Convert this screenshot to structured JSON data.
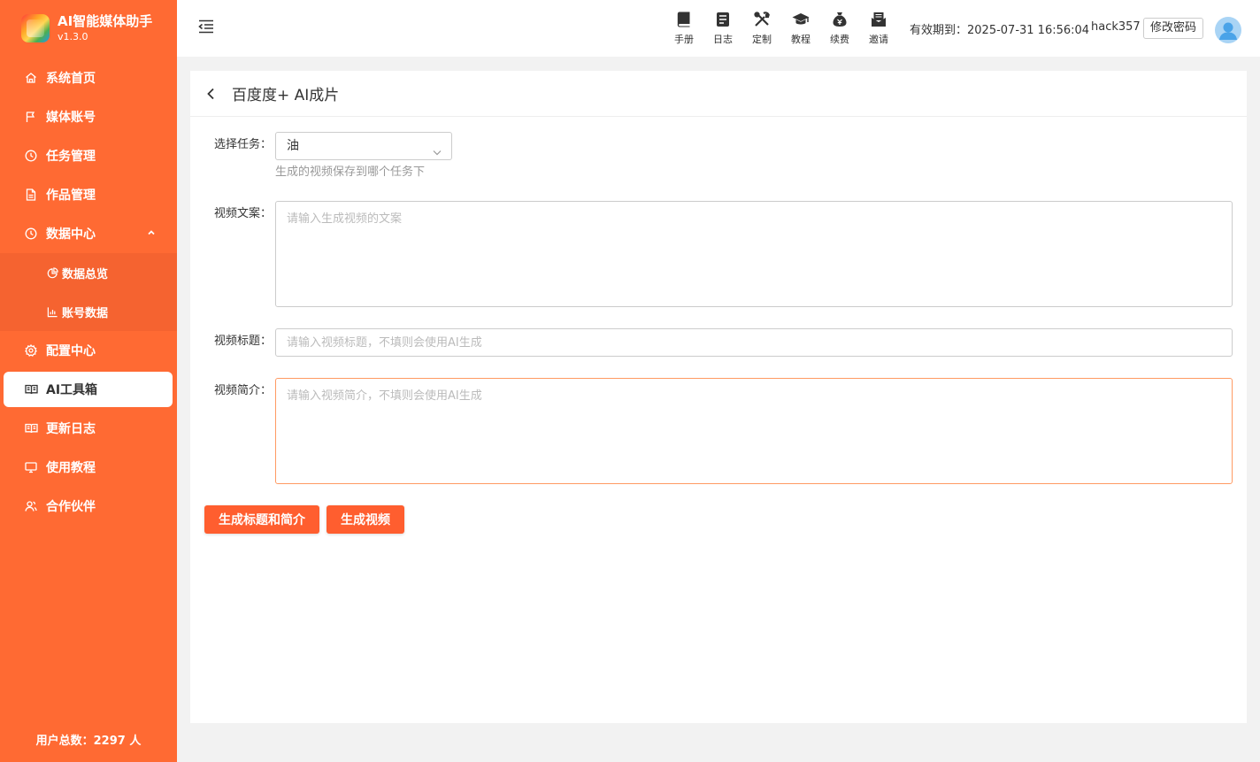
{
  "brand": {
    "title": "AI智能媒体助手",
    "version": "v1.3.0"
  },
  "sidebar": {
    "items": [
      {
        "label": "系统首页",
        "icon": "home-icon"
      },
      {
        "label": "媒体账号",
        "icon": "flag-icon"
      },
      {
        "label": "任务管理",
        "icon": "clock-icon"
      },
      {
        "label": "作品管理",
        "icon": "document-icon"
      },
      {
        "label": "数据中心",
        "icon": "clock-icon",
        "expanded": true,
        "children": [
          {
            "label": "数据总览",
            "icon": "pie-chart-icon"
          },
          {
            "label": "账号数据",
            "icon": "bar-chart-icon"
          }
        ]
      },
      {
        "label": "配置中心",
        "icon": "gear-icon"
      },
      {
        "label": "AI工具箱",
        "icon": "book-icon",
        "active": true
      },
      {
        "label": "更新日志",
        "icon": "book-icon"
      },
      {
        "label": "使用教程",
        "icon": "monitor-icon"
      },
      {
        "label": "合作伙伴",
        "icon": "users-icon"
      }
    ],
    "footer": "用户总数：2297 人"
  },
  "header": {
    "toolbar": [
      {
        "label": "手册",
        "icon": "book-icon"
      },
      {
        "label": "日志",
        "icon": "log-icon"
      },
      {
        "label": "定制",
        "icon": "tools-icon"
      },
      {
        "label": "教程",
        "icon": "graduation-cap-icon"
      },
      {
        "label": "续费",
        "icon": "money-bag-icon"
      },
      {
        "label": "邀请",
        "icon": "mail-icon"
      }
    ],
    "expire": "有效期到：2025-07-31 16:56:04",
    "username": "hack357",
    "change_password": "修改密码"
  },
  "page": {
    "title": "百度度+ AI成片",
    "task": {
      "label": "选择任务：",
      "value": "油",
      "help": "生成的视频保存到哪个任务下"
    },
    "copy": {
      "label": "视频文案：",
      "placeholder": "请输入生成视频的文案",
      "value": ""
    },
    "video_title": {
      "label": "视频标题：",
      "placeholder": "请输入视频标题，不填则会使用AI生成",
      "value": ""
    },
    "intro": {
      "label": "视频简介：",
      "placeholder": "请输入视频简介，不填则会使用AI生成",
      "value": ""
    },
    "buttons": {
      "generate_title_intro": "生成标题和简介",
      "generate_video": "生成视频"
    }
  },
  "colors": {
    "accent": "#ff6a33",
    "button": "#ff5e2f",
    "focus_border": "#ff9a63"
  }
}
